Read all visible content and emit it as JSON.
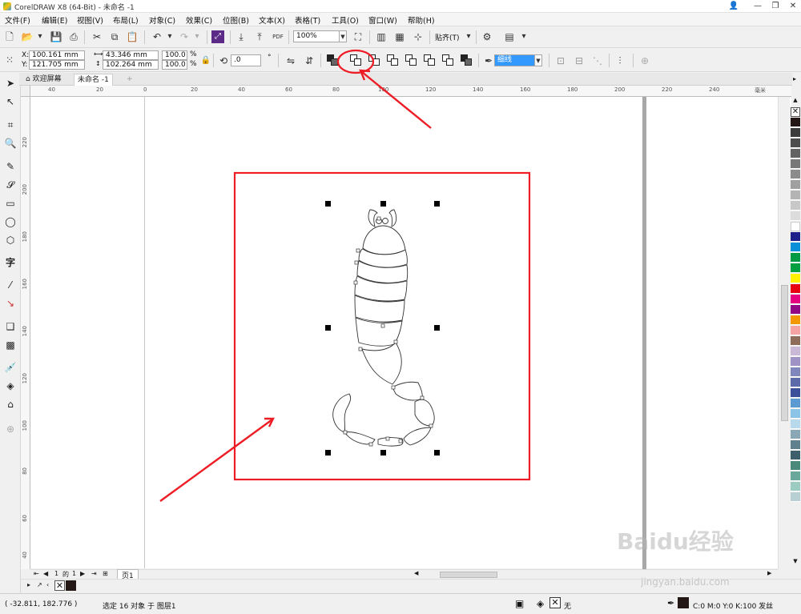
{
  "window": {
    "title": "CorelDRAW X8 (64-Bit) - 未命名 -1"
  },
  "menu": [
    "文件(F)",
    "编辑(E)",
    "视图(V)",
    "布局(L)",
    "对象(C)",
    "效果(C)",
    "位图(B)",
    "文本(X)",
    "表格(T)",
    "工具(O)",
    "窗口(W)",
    "帮助(H)"
  ],
  "toolbar": {
    "zoom": "100%",
    "snap_label": "贴齐(T)",
    "pdf_label": "PDF"
  },
  "properties": {
    "x": "100.161 mm",
    "y": "121.705 mm",
    "width": "43.346 mm",
    "height": "102.264 mm",
    "scale_x": "100.0",
    "scale_y": "100.0",
    "percent": "%",
    "x_label": "X:",
    "y_label": "Y:",
    "rotation": ".0",
    "outline": "细线"
  },
  "tabs": {
    "welcome": "欢迎屏幕",
    "document": "未命名 -1",
    "add": "+"
  },
  "rulers": {
    "h_ticks": [
      "40",
      "20",
      "0",
      "20",
      "40",
      "60",
      "80",
      "100",
      "120",
      "140",
      "160",
      "180",
      "200",
      "220",
      "240"
    ],
    "h_unit": "毫米",
    "v_ticks": [
      "220",
      "200",
      "180",
      "160",
      "140",
      "120",
      "100",
      "80",
      "60",
      "40"
    ]
  },
  "page_nav": {
    "current": "1",
    "of_label": "的",
    "total": "1",
    "page_tab": "页1"
  },
  "status": {
    "coords": "( -32.811, 182.776 )",
    "selection": "选定 16 对象 于 图层1",
    "fill_none": "无",
    "color_info": "C:0 M:0 Y:0 K:100  发丝"
  },
  "palette_colors": [
    "#231815",
    "#3c3c3c",
    "#4d4d4d",
    "#636363",
    "#787878",
    "#8c8c8c",
    "#a0a0a0",
    "#b4b4b4",
    "#c8c8c8",
    "#dcdcdc",
    "#ffffff",
    "#1d2088",
    "#0a90d8",
    "#009944",
    "#00a040",
    "#fff100",
    "#e60012",
    "#e4007f",
    "#920783",
    "#f39800",
    "#f5a3a3",
    "#8e6e5a",
    "#c9b9d6",
    "#9f93c6",
    "#7f87bd",
    "#5d6aaa",
    "#3c4f99",
    "#5c9bd1",
    "#8cc4e8",
    "#b8d8ec",
    "#8aa7b5",
    "#61808e",
    "#3e5e6b",
    "#4b8a7a",
    "#6aa89c",
    "#9ccbc1",
    "#b8cfd4"
  ],
  "accent": {
    "annotation_red": "#ee1c25",
    "selected_field_bg": "#3399ff"
  },
  "watermark": {
    "logo": "Baidu经验",
    "url": "jingyan.baidu.com"
  }
}
